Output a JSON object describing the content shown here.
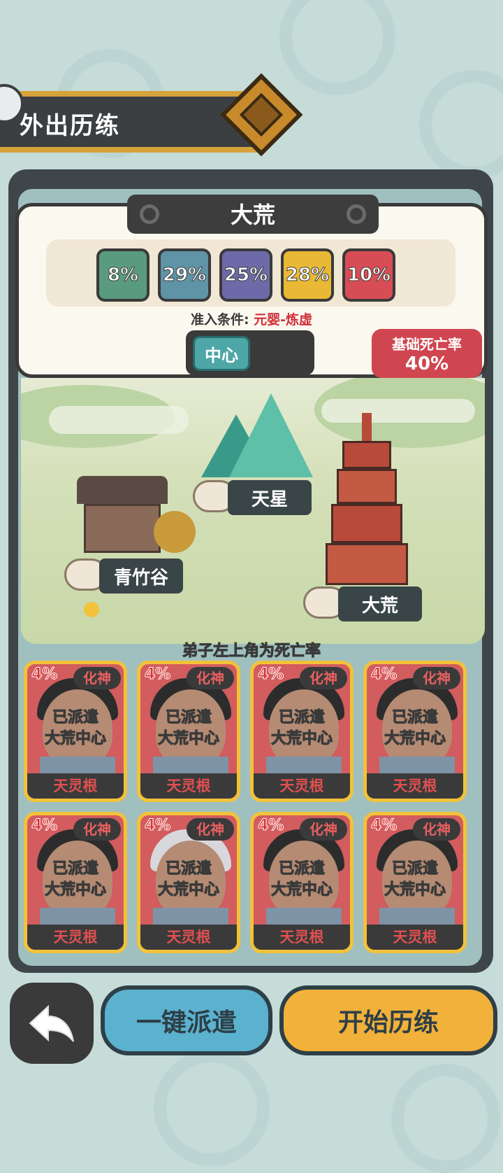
{
  "header": {
    "title": "外出历练"
  },
  "zone": {
    "title": "大荒",
    "rates": [
      {
        "text": "8%",
        "color": "#5a9a7e"
      },
      {
        "text": "29%",
        "color": "#5f93a6"
      },
      {
        "text": "25%",
        "color": "#6c6aa8"
      },
      {
        "text": "28%",
        "color": "#e9b935"
      },
      {
        "text": "10%",
        "color": "#d84d55"
      }
    ],
    "requirement_label": "准入条件:",
    "requirement_value": "元婴-炼虚",
    "location_option": "中心",
    "death_rate_label": "基础死亡率",
    "death_rate_value": "40%"
  },
  "map": {
    "locations": [
      "青竹谷",
      "天星",
      "大荒"
    ],
    "hint": "弟子左上角为死亡率"
  },
  "disciples": [
    {
      "rate": "4%",
      "rank": "化神",
      "status_line1": "已派遣",
      "status_line2": "大荒中心",
      "root": "天灵根"
    },
    {
      "rate": "4%",
      "rank": "化神",
      "status_line1": "已派遣",
      "status_line2": "大荒中心",
      "root": "天灵根"
    },
    {
      "rate": "4%",
      "rank": "化神",
      "status_line1": "已派遣",
      "status_line2": "大荒中心",
      "root": "天灵根"
    },
    {
      "rate": "4%",
      "rank": "化神",
      "status_line1": "已派遣",
      "status_line2": "大荒中心",
      "root": "天灵根"
    },
    {
      "rate": "4%",
      "rank": "化神",
      "status_line1": "已派遣",
      "status_line2": "大荒中心",
      "root": "天灵根"
    },
    {
      "rate": "4%",
      "rank": "化神",
      "status_line1": "已派遣",
      "status_line2": "大荒中心",
      "root": "天灵根"
    },
    {
      "rate": "4%",
      "rank": "化神",
      "status_line1": "已派遣",
      "status_line2": "大荒中心",
      "root": "天灵根"
    },
    {
      "rate": "4%",
      "rank": "化神",
      "status_line1": "已派遣",
      "status_line2": "大荒中心",
      "root": "天灵根"
    }
  ],
  "buttons": {
    "back_icon": "back-arrow-icon",
    "dispatch": "一键派遣",
    "start": "开始历练"
  }
}
